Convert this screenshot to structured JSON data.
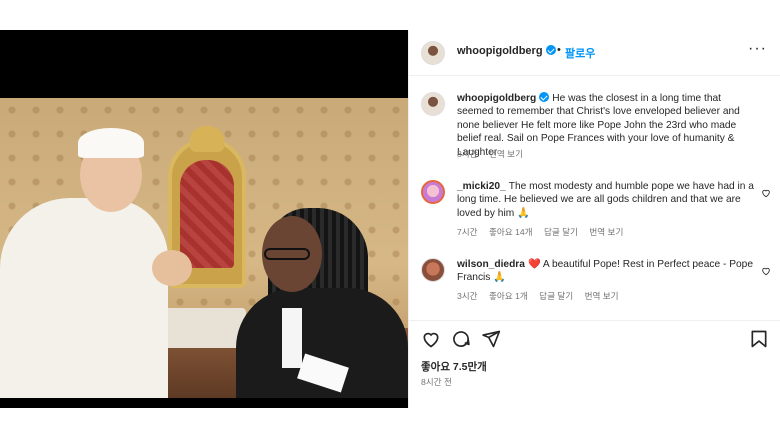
{
  "post": {
    "username": "whoopigoldberg",
    "dot": "•",
    "follow_label": "팔로우",
    "more_label": "···"
  },
  "caption": {
    "username": "whoopigoldberg",
    "text": "He was the closest in a long time that seemed to remember that Christ's love enveloped believer and none believer  He felt more like Pope John the 23rd who made belief real. Sail on Pope Frances with your love of humanity & Laughter",
    "time": "8시간",
    "translate": "번역 보기"
  },
  "comments": [
    {
      "username": "_micki20_",
      "text": "The most modesty and humble pope we have had in a long time. He believed we are all gods children and that we are loved by him 🙏",
      "time": "7시간",
      "likes": "좋아요 14개",
      "reply": "답글 달기",
      "translate": "번역 보기"
    },
    {
      "username": "wilson_diedra",
      "text": "❤️ A beautiful Pope! Rest in Perfect peace - Pope Francis 🙏",
      "time": "3시간",
      "likes": "좋아요 1개",
      "reply": "답글 달기",
      "translate": "번역 보기"
    }
  ],
  "footer": {
    "likes": "좋아요 7.5만개",
    "time_ago": "8시간 전"
  },
  "icons": {
    "like": "heart-icon",
    "comment": "comment-icon",
    "share": "send-icon",
    "save": "bookmark-icon"
  },
  "colors": {
    "accent": "#0095f6",
    "text": "#262626",
    "muted": "#737373"
  }
}
